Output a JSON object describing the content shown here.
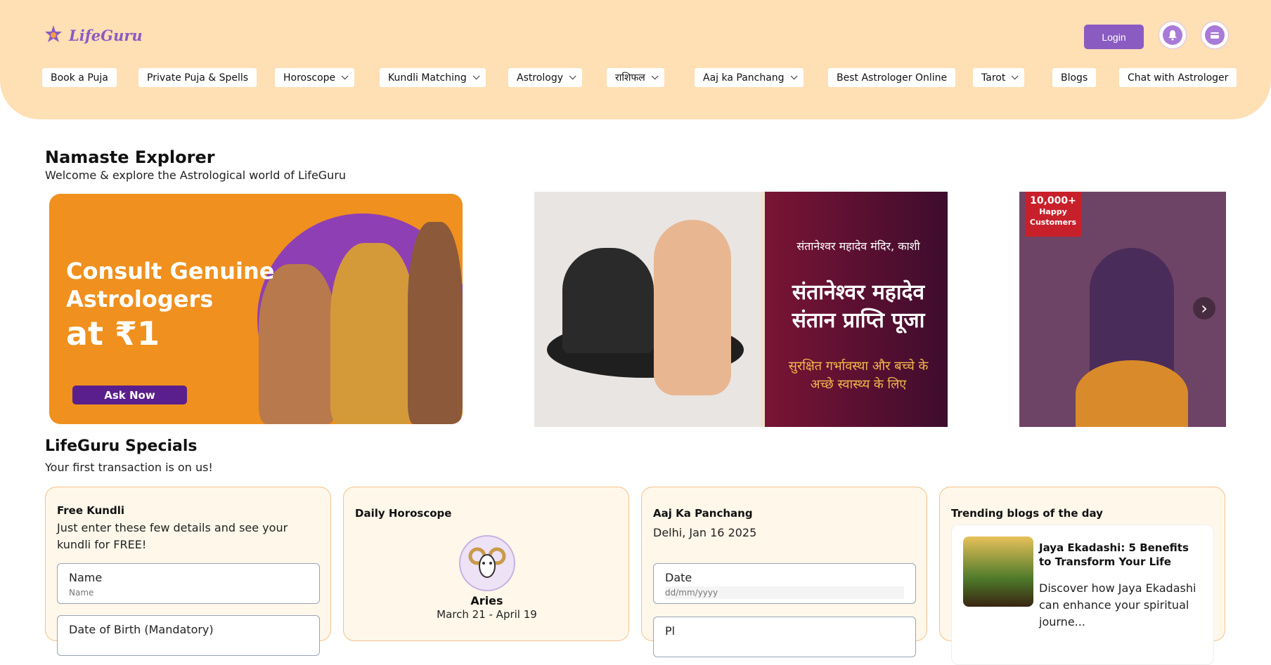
{
  "brand": {
    "name": "LifeGuru",
    "accent": "#8a5cc2",
    "header_bg": "#ffdfb4"
  },
  "header": {
    "login_label": "Login",
    "nav": [
      {
        "label": "Book a Puja",
        "dropdown": false
      },
      {
        "label": "Private Puja & Spells",
        "dropdown": false
      },
      {
        "label": "Horoscope",
        "dropdown": true
      },
      {
        "label": "Kundli Matching",
        "dropdown": true
      },
      {
        "label": "Astrology",
        "dropdown": true
      },
      {
        "label": "राशिफल",
        "dropdown": true
      },
      {
        "label": "Aaj ka Panchang",
        "dropdown": true
      },
      {
        "label": "Best Astrologer Online",
        "dropdown": false
      },
      {
        "label": "Tarot",
        "dropdown": true
      },
      {
        "label": "Blogs",
        "dropdown": false
      },
      {
        "label": "Chat with Astrologer",
        "dropdown": false
      }
    ]
  },
  "welcome": {
    "title": "Namaste Explorer",
    "subtitle": "Welcome & explore the Astrological world of LifeGuru"
  },
  "banners": {
    "b1": {
      "line1": "Consult Genuine",
      "line2": "Astrologers",
      "price": "at ₹1",
      "cta": "Ask Now"
    },
    "b2": {
      "top": "संतानेश्वर महादेव मंदिर, काशी",
      "title1": "संतानेश्वर महादेव",
      "title2": "संतान प्राप्ति पूजा",
      "sub1": "सुरक्षित गर्भावस्था और बच्चे के",
      "sub2": "अच्छे स्वास्थ्य के लिए"
    },
    "b3": {
      "badge_count": "10,000+",
      "badge_line1": "Happy",
      "badge_line2": "Customers"
    }
  },
  "specials": {
    "title": "LifeGuru Specials",
    "subtitle": "Your first transaction is on us!"
  },
  "cards": {
    "kundli": {
      "title": "Free Kundli",
      "desc": "Just enter these few details and see your kundli for FREE!",
      "name_label": "Name",
      "name_placeholder": "Name",
      "dob_label": "Date of Birth (Mandatory)"
    },
    "horoscope": {
      "title": "Daily Horoscope",
      "sign": "Aries",
      "dates": "March 21 - April 19"
    },
    "panchang": {
      "title": "Aaj Ka Panchang",
      "location_date": "Delhi, Jan 16 2025",
      "date_label": "Date",
      "date_placeholder": "dd/mm/yyyy",
      "place_label": "Pl"
    },
    "blogs": {
      "title": "Trending blogs of the day",
      "blog_title": "Jaya Ekadashi: 5 Benefits to Transform Your Life",
      "blog_excerpt": "Discover how Jaya Ekadashi can enhance your spiritual journe..."
    }
  },
  "icons": {
    "logo": "lotus-star-icon",
    "notification": "bell-icon",
    "wallet": "wallet-icon",
    "next": "chevron-right-icon",
    "zodiac": "ram-icon"
  }
}
